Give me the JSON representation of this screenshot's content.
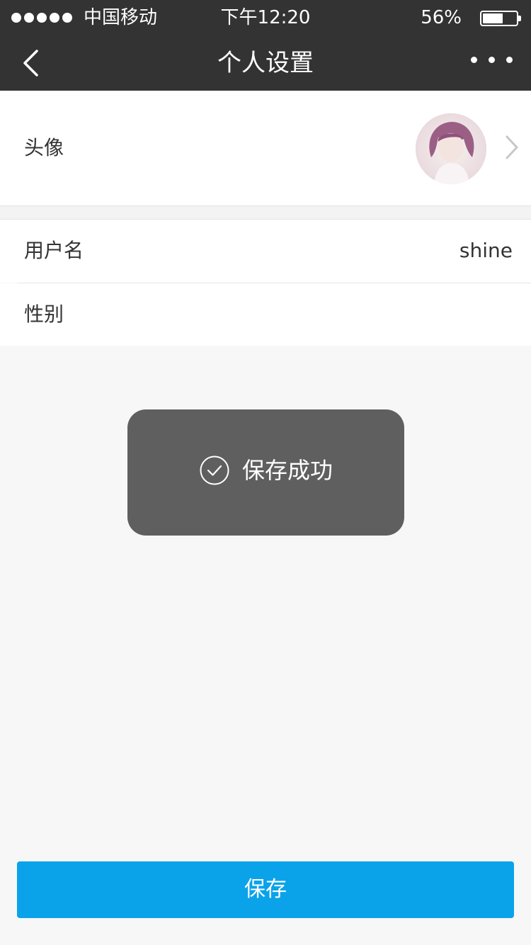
{
  "status_bar": {
    "carrier": "中国移动",
    "time": "下午12:20",
    "battery": "56%",
    "signal_icon": "signal-dots-icon",
    "battery_icon": "battery-icon"
  },
  "navbar": {
    "title": "个人设置",
    "back_icon": "chevron-left-icon",
    "more_icon": "more-dots-icon"
  },
  "profile": {
    "avatar_label": "头像",
    "username_label": "用户名",
    "username_value": "shine",
    "gender_label": "性别",
    "gender_value": ""
  },
  "toast": {
    "message": "保存成功",
    "icon": "check-circle-icon"
  },
  "actions": {
    "save_label": "保存"
  },
  "colors": {
    "nav_bg": "#333333",
    "page_bg": "#f7f7f7",
    "toast_bg": "#5f5f5f",
    "save_button": "#0aa3ea"
  }
}
